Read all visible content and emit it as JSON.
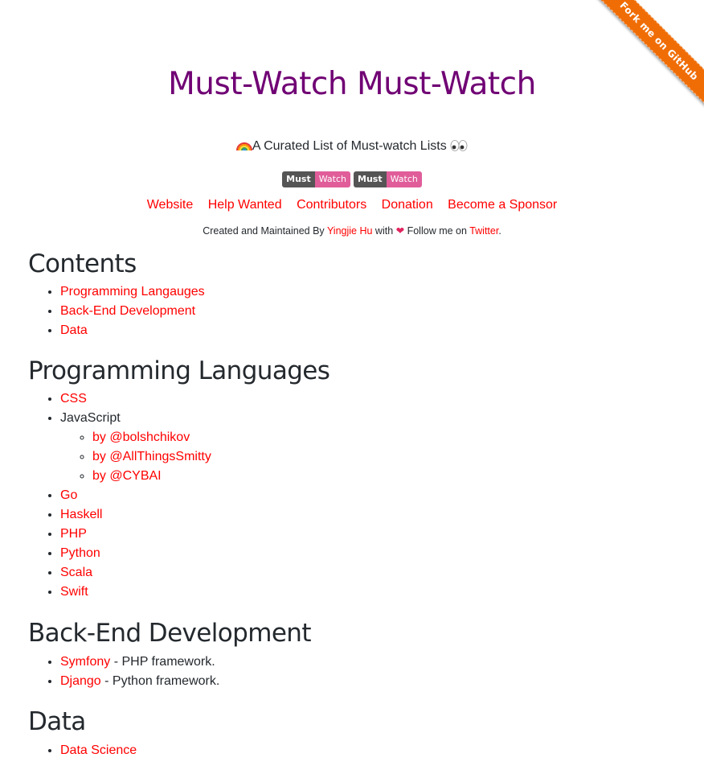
{
  "ribbon": {
    "label": "Fork me on GitHub"
  },
  "header": {
    "title": "Must-Watch Must-Watch",
    "tagline": "A Curated List of Must-watch Lists",
    "badges": [
      {
        "left": "Must",
        "right": "Watch"
      },
      {
        "left": "Must",
        "right": "Watch"
      }
    ],
    "links": [
      "Website",
      "Help Wanted",
      "Contributors",
      "Donation",
      "Become a Sponsor"
    ],
    "credit": {
      "prefix": "Created and Maintained By ",
      "author": "Yingjie Hu",
      "middle": " with ",
      "follow": " Follow me on ",
      "twitter": "Twitter",
      "suffix": "."
    }
  },
  "sections": {
    "contents": {
      "heading": "Contents",
      "items": [
        "Programming Langauges",
        "Back-End Development",
        "Data"
      ]
    },
    "programming": {
      "heading": "Programming Languages",
      "css": "CSS",
      "javascript": "JavaScript",
      "js_subitems": [
        "by @bolshchikov",
        "by @AllThingsSmitty",
        "by @CYBAI"
      ],
      "items": [
        "Go",
        "Haskell",
        "PHP",
        "Python",
        "Scala",
        "Swift"
      ]
    },
    "backend": {
      "heading": "Back-End Development",
      "items": [
        {
          "link": "Symfony",
          "desc": " - PHP framework."
        },
        {
          "link": "Django",
          "desc": " - Python framework."
        }
      ]
    },
    "data": {
      "heading": "Data",
      "items": [
        "Data Science"
      ]
    }
  },
  "colors": {
    "title": "#700074",
    "link": "#ff0000",
    "ribbon": "#f06d06",
    "badge_left": "#555555",
    "badge_right": "#e05d9a"
  }
}
